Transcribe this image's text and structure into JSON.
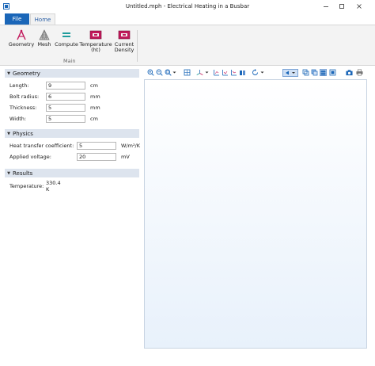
{
  "window": {
    "title": "Untitled.mph - Electrical Heating in a Busbar",
    "minimize": "–",
    "maximize": "☐",
    "close": "✕"
  },
  "tabs": {
    "file": "File",
    "home": "Home"
  },
  "ribbon": {
    "group_label": "Main",
    "buttons": [
      {
        "label": "Geometry",
        "icon": "geometry-icon"
      },
      {
        "label": "Mesh",
        "icon": "mesh-icon"
      },
      {
        "label": "Compute",
        "icon": "compute-icon"
      },
      {
        "label": "Temperature\n(ht)",
        "label1": "Temperature",
        "label2": "(ht)",
        "icon": "temperature-plot-icon"
      },
      {
        "label": "Current\nDensity",
        "label1": "Current",
        "label2": "Density",
        "icon": "current-density-plot-icon"
      }
    ]
  },
  "geometry": {
    "title": "Geometry",
    "fields": [
      {
        "label": "Length:",
        "value": "9",
        "unit": "cm"
      },
      {
        "label": "Bolt radius:",
        "value": "6",
        "unit": "mm"
      },
      {
        "label": "Thickness:",
        "value": "5",
        "unit": "mm"
      },
      {
        "label": "Width:",
        "value": "5",
        "unit": "cm"
      }
    ]
  },
  "physics": {
    "title": "Physics",
    "fields": [
      {
        "label": "Heat transfer coefficient:",
        "value": "5",
        "unit": "W/m²/K"
      },
      {
        "label": "Applied voltage:",
        "value": "20",
        "unit": "mV"
      }
    ]
  },
  "results": {
    "title": "Results",
    "temperature_label": "Temperature:",
    "temperature_value": "330.4 K"
  },
  "colors": {
    "accent": "#1a66b8",
    "section_header": "#dde4ee",
    "magenta_icon": "#c2185b",
    "teal_icon": "#1f9c9c"
  }
}
